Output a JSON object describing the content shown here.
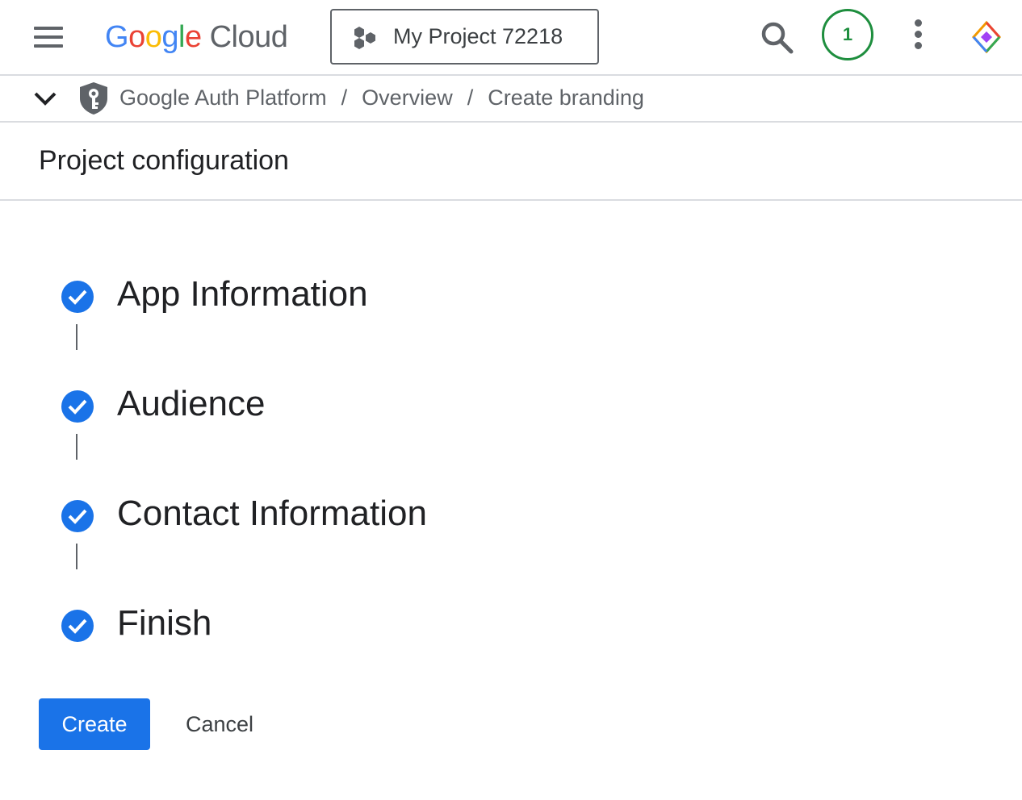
{
  "topbar": {
    "logo_parts": [
      "G",
      "o",
      "o",
      "g",
      "l",
      "e"
    ],
    "logo_product": "Cloud",
    "project_label": "My Project 72218",
    "notification_count": "1"
  },
  "breadcrumb": {
    "items": [
      "Google Auth Platform",
      "Overview",
      "Create branding"
    ],
    "separator": "/"
  },
  "page": {
    "title": "Project configuration"
  },
  "stepper": {
    "steps": [
      {
        "label": "App Information",
        "status": "complete"
      },
      {
        "label": "Audience",
        "status": "complete"
      },
      {
        "label": "Contact Information",
        "status": "complete"
      },
      {
        "label": "Finish",
        "status": "complete"
      }
    ]
  },
  "actions": {
    "create_label": "Create",
    "cancel_label": "Cancel"
  },
  "colors": {
    "primary": "#1a73e8",
    "notification_ring": "#1e8e3e",
    "divider": "#dadce0",
    "icon_grey": "#5f6368"
  }
}
